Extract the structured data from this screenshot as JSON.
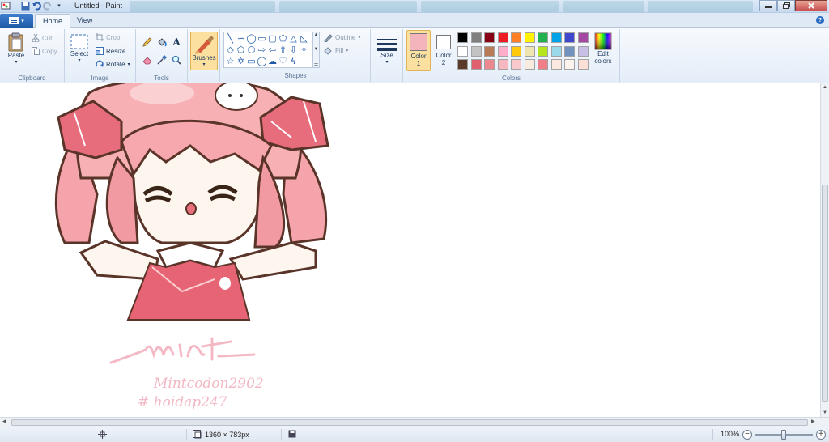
{
  "titlebar": {
    "title": "Untitled - Paint"
  },
  "tabs": {
    "file": "",
    "home": "Home",
    "view": "View"
  },
  "ribbon": {
    "clipboard": {
      "paste": "Paste",
      "cut": "Cut",
      "copy": "Copy",
      "label": "Clipboard"
    },
    "image": {
      "select": "Select",
      "crop": "Crop",
      "resize": "Resize",
      "rotate": "Rotate",
      "label": "Image"
    },
    "tools": {
      "label": "Tools"
    },
    "brushes": {
      "label": "Brushes"
    },
    "shapes": {
      "outline": "Outline",
      "fill": "Fill",
      "label": "Shapes"
    },
    "size": {
      "label": "Size"
    },
    "colors": {
      "color1": "Color\n1",
      "color2": "Color\n2",
      "edit": "Edit colors",
      "label": "Colors",
      "color1_value": "#f4b4bc",
      "color2_value": "#ffffff",
      "palette": [
        "#000000",
        "#7f7f7f",
        "#880015",
        "#ed1c24",
        "#ff7f27",
        "#fff200",
        "#22b14c",
        "#00a2e8",
        "#3f48cc",
        "#a349a4",
        "#ffffff",
        "#c3c3c3",
        "#b97a57",
        "#ffaec9",
        "#ffc90e",
        "#efe4b0",
        "#b5e61d",
        "#99d9ea",
        "#7092be",
        "#c8bfe7",
        "#5a3a2a",
        "#e06070",
        "#ee8890",
        "#f8b8c0",
        "#f9c8cc",
        "#f8ece0",
        "#f08088",
        "#fbe8e0",
        "#fdf4ee",
        "#fce0d8"
      ]
    }
  },
  "canvas": {
    "signature": "mint",
    "credit_line1": "Mintcodon2902",
    "credit_line2": "# hoidap247"
  },
  "statusbar": {
    "dimensions": "1360 × 783px",
    "zoom": "100%"
  }
}
